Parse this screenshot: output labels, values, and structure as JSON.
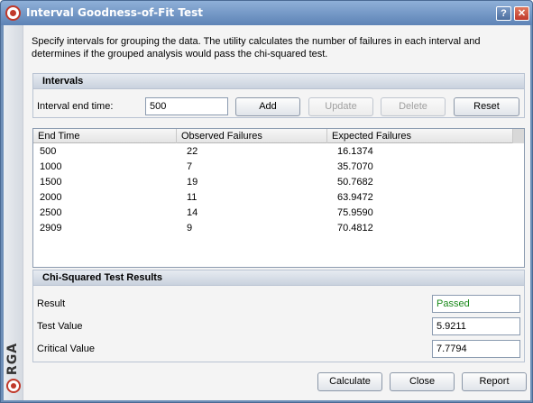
{
  "window": {
    "title": "Interval Goodness-of-Fit Test",
    "help_glyph": "?",
    "close_glyph": "✕",
    "accent": "#5d83b6",
    "brand_label": "RGA"
  },
  "description": "Specify intervals for grouping the data. The utility calculates the number of failures in each interval and determines if the grouped analysis would pass the chi-squared test.",
  "intervals": {
    "header": "Intervals",
    "end_time_label": "Interval end time:",
    "end_time_value": "500",
    "add_label": "Add",
    "update_label": "Update",
    "delete_label": "Delete",
    "reset_label": "Reset"
  },
  "table": {
    "columns": [
      "End Time",
      "Observed Failures",
      "Expected Failures"
    ],
    "rows": [
      [
        "500",
        "22",
        "16.1374"
      ],
      [
        "1000",
        "7",
        "35.7070"
      ],
      [
        "1500",
        "19",
        "50.7682"
      ],
      [
        "2000",
        "11",
        "63.9472"
      ],
      [
        "2500",
        "14",
        "75.9590"
      ],
      [
        "2909",
        "9",
        "70.4812"
      ]
    ]
  },
  "chi": {
    "header": "Chi-Squared Test Results",
    "result_label": "Result",
    "result_value": "Passed",
    "result_color": "#1a8a1a",
    "test_label": "Test Value",
    "test_value": "5.9211",
    "critical_label": "Critical Value",
    "critical_value": "7.7794"
  },
  "footer": {
    "calculate_label": "Calculate",
    "close_label": "Close",
    "report_label": "Report"
  }
}
